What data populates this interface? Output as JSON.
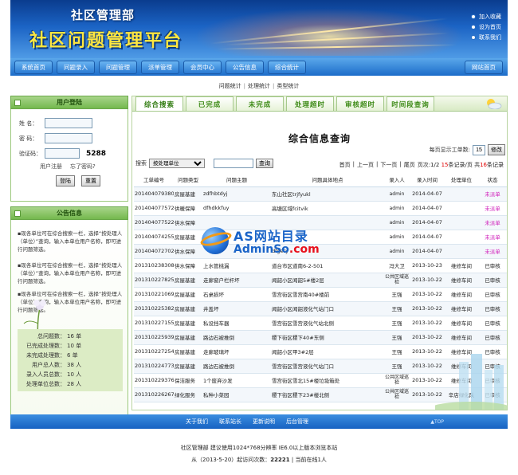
{
  "header": {
    "org_name": "社区管理部",
    "system_title": "社区问题管理平台",
    "links": [
      "加入收藏",
      "设为首页",
      "联系我们"
    ]
  },
  "nav": {
    "items": [
      "系统首页",
      "问题录入",
      "问题管理",
      "派单管理",
      "会员中心",
      "公告信息",
      "综合统计"
    ],
    "home": "网站首页"
  },
  "subnav": {
    "items": [
      "问题统计",
      "处理统计",
      "类型统计"
    ],
    "sep": "|"
  },
  "login": {
    "title": "用户登陆",
    "name_label": "姓  名：",
    "password_label": "密  码：",
    "code_label": "验证码：",
    "code_value": "5288",
    "register": "用户注册",
    "forgot": "忘了密码?",
    "login_btn": "登陆",
    "reset_btn": "重置"
  },
  "notice": {
    "title": "公告信息",
    "items": [
      "现各单位可在综合搜索一栏，选择“按处理人（单位）”查询，输入本单位用户名称，即可进行问题筛选。",
      "现各单位可在综合搜索一栏，选择“按处理人（单位）”查询，输入本单位用户名称，即可进行问题筛选。",
      "现各单位可在综合搜索一栏，选择“按处理人（单位）”查询，输入本单位用户名称，即可进行问题筛选。"
    ],
    "stats": [
      {
        "k": "总问题数：",
        "v": "16 单"
      },
      {
        "k": "已完成处理数：",
        "v": "10 单"
      },
      {
        "k": "未完成处理数：",
        "v": "6 单"
      },
      {
        "k": "用户总人数：",
        "v": "38 人"
      },
      {
        "k": "录入人员总数：",
        "v": "10 人"
      },
      {
        "k": "处理单位总数：",
        "v": "28 人"
      }
    ]
  },
  "main": {
    "tabs": [
      "综合搜索",
      "已完成",
      "未完成",
      "处理超时",
      "审核超时",
      "时间段查询"
    ],
    "title": "综合信息查询",
    "per_page_label": "每页显示工单数:",
    "per_page_value": "15",
    "modify_btn": "修改",
    "search_label": "搜索",
    "search_select": "按处理单位",
    "search_btn": "查询",
    "pager": {
      "first": "首页",
      "prev": "上一页",
      "next": "下一页",
      "last": "尾页",
      "page_prefix": "页次:1/2",
      "per_page_red": "15",
      "per_page_suffix": "条记录/页 共",
      "total_red": "16",
      "total_suffix": "条记录",
      "sep": "|"
    },
    "columns": [
      "工单编号",
      "问题类型",
      "问题主题",
      "问题具体地点",
      "录入人",
      "录入时间",
      "处理单位",
      "状态"
    ],
    "rows": [
      [
        "201404079380",
        "房屋基建",
        "zdfhbtdyj",
        "东山社区trjfyukl",
        "admin",
        "2014-04-07",
        "",
        "未派单"
      ],
      [
        "201404077572",
        "供暖保障",
        "dfhdkkfuy",
        "高塘区域fcitvik",
        "admin",
        "2014-04-07",
        "",
        "未派单"
      ],
      [
        "201404077522",
        "供水保障",
        "",
        "",
        "admin",
        "2014-04-07",
        "",
        "未派单"
      ],
      [
        "201404074255",
        "房屋基建",
        "",
        "",
        "admin",
        "2014-04-07",
        "",
        "未派单"
      ],
      [
        "201404072702",
        "供水保障",
        "",
        "dfgety",
        "admin",
        "2014-04-07",
        "",
        "未派单"
      ],
      [
        "201310238308",
        "供水保障",
        "上水管桃漏",
        "道台市区道南6-2-501",
        "冯大卫",
        "2013-10-23",
        "维修车间",
        "已审核"
      ],
      [
        "201310227825",
        "房屋基建",
        "走廊窗户栏杆坏",
        "闻韶小区闻韶5#楼2层",
        "公共区域巡检",
        "2013-10-22",
        "维修车间",
        "已审核"
      ],
      [
        "201310221069",
        "房屋基建",
        "石桌损坏",
        "雪宫街区雪宫南40#楼前",
        "王强",
        "2013-10-22",
        "维修车间",
        "已审核"
      ],
      [
        "201310225382",
        "房屋基建",
        "井盖坏",
        "闻韶小区闻韶液化气站门口",
        "王强",
        "2013-10-22",
        "维修车间",
        "已审核"
      ],
      [
        "201310227155",
        "房屋基建",
        "私设挡车器",
        "雪宫街区雪宫液化气站北侧",
        "王强",
        "2013-10-22",
        "维修车间",
        "已审核"
      ],
      [
        "201310225939",
        "房屋基建",
        "路边石被推倒",
        "稷下街区稷下40#东侧",
        "王强",
        "2013-10-22",
        "维修车间",
        "已审核"
      ],
      [
        "201310227254",
        "房屋基建",
        "走廊玻璃坏",
        "闻韶小区甲3#2层",
        "王强",
        "2013-10-22",
        "维修车间",
        "已审核"
      ],
      [
        "201310224773",
        "房屋基建",
        "路边石被推倒",
        "雪宫街区雪宫液化气站门口",
        "王强",
        "2013-10-22",
        "维修车间",
        "已审核"
      ],
      [
        "201310229376",
        "保洁服务",
        "1个废弃沙发",
        "雪宫街区雪北15#楼垃圾箱处",
        "公共区域巡检",
        "2013-10-22",
        "维修车间",
        "已审核"
      ],
      [
        "201310226267",
        "绿化服务",
        "私种小菜园",
        "稷下街区稷下23#楼北侧",
        "公共区域巡检",
        "2013-10-22",
        "辛店绿化队",
        "已审核"
      ]
    ]
  },
  "watermark": {
    "line1": "AS网站目录",
    "line2_a": "AdminSo",
    "line2_b": ".com"
  },
  "footer": {
    "links": [
      "关于我们",
      "联系站长",
      "更新说明",
      "后台管理"
    ],
    "top": "▲TOP",
    "line1": "社区管理部  建议使用1024*768分辨率  IE6.0以上版本浏览本站",
    "line2_a": "从（2013-5-20）起访问次数：",
    "line2_count": "22221",
    "line2_b": "  |  当前在线1人"
  }
}
